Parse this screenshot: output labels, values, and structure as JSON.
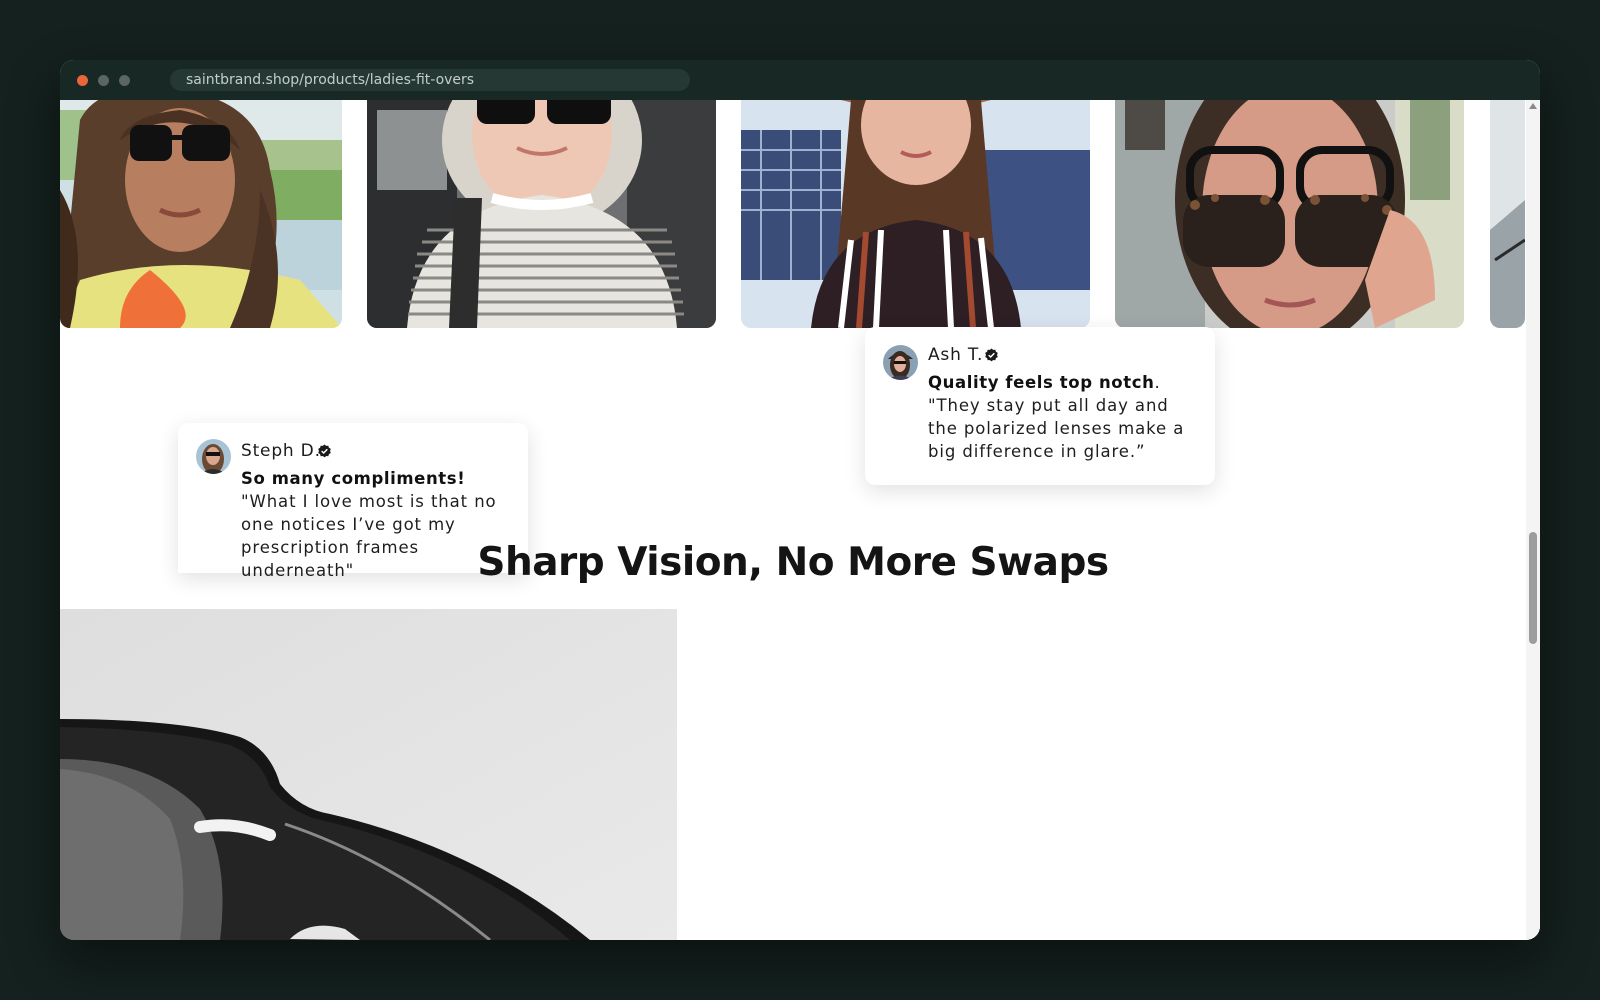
{
  "browser": {
    "url": "saintbrand.shop/products/ladies-fit-overs"
  },
  "gallery": {
    "photos": [
      {
        "name": "photo-woman-curly-hair-sunglasses"
      },
      {
        "name": "photo-woman-car-sunglasses"
      },
      {
        "name": "photo-woman-hat-striped-top"
      },
      {
        "name": "photo-woman-fit-over-tortoise-sunglasses"
      },
      {
        "name": "photo-partial-next"
      }
    ]
  },
  "reviews": [
    {
      "reviewer": "Steph D.",
      "headline": "So many compliments!",
      "body": " \"What I love most is that no one notices I’ve got my prescription frames underneath\""
    },
    {
      "reviewer": "Ash T.",
      "headline": "Quality feels top notch",
      "body": ". \"They stay put all day and the polarized lenses make a big difference in glare.”"
    }
  ],
  "section": {
    "title": "Sharp Vision, No More Swaps"
  },
  "icons": {
    "verified": "verified-badge-icon",
    "close": "window-close-dot",
    "scroll_up": "scroll-up-arrow-icon"
  }
}
